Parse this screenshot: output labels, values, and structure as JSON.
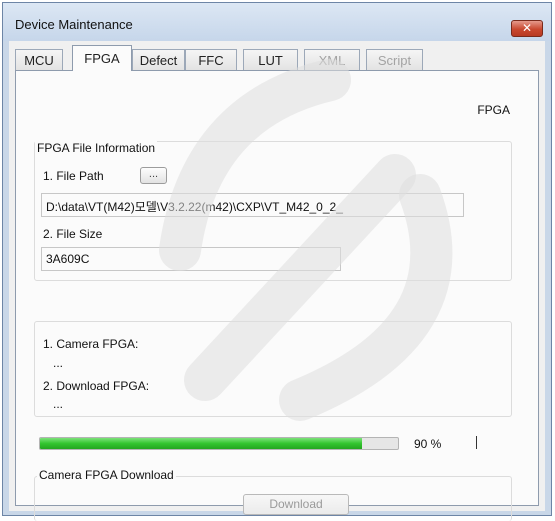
{
  "window": {
    "title": "Device Maintenance",
    "close_glyph": "✕"
  },
  "tabs": [
    {
      "label": "MCU",
      "state": "normal"
    },
    {
      "label": "FPGA",
      "state": "active"
    },
    {
      "label": "Defect",
      "state": "normal"
    },
    {
      "label": "FFC",
      "state": "normal"
    },
    {
      "label": "LUT",
      "state": "normal"
    },
    {
      "label": "XML",
      "state": "disabled"
    },
    {
      "label": "Script",
      "state": "disabled"
    }
  ],
  "panel": {
    "heading": "FPGA",
    "file_info": {
      "title": "FPGA File Information",
      "file_path_label": "1. File Path",
      "browse_label": "...",
      "file_path_value": "D:\\data\\VT(M42)모델\\V3.2.22(m42)\\CXP\\VT_M42_0_2_",
      "file_size_label": "2. File Size",
      "file_size_value": "3A609C"
    },
    "versions": {
      "camera_label": "1. Camera FPGA:",
      "camera_value": "...",
      "download_label": "2. Download FPGA:",
      "download_value": "..."
    },
    "progress": {
      "percent": 90,
      "text": "90 %"
    },
    "download_group": {
      "title": "Camera FPGA Download",
      "button_label": "Download"
    }
  },
  "colors": {
    "progress_fill": "#33c52f",
    "close_button": "#c9482f",
    "title_bar": "#c9d7e8"
  },
  "icons": {
    "close": "close-icon",
    "browse": "ellipsis-icon"
  }
}
